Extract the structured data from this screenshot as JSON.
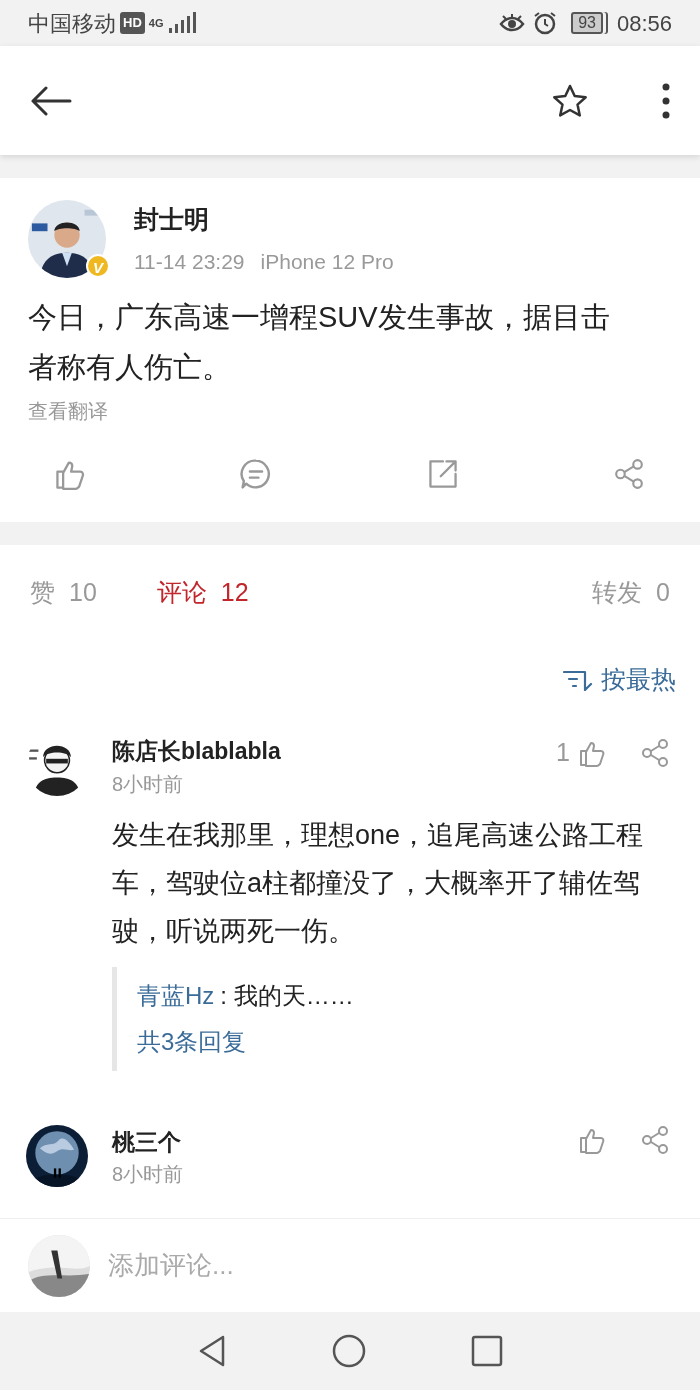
{
  "status_bar": {
    "carrier": "中国移动",
    "hd": "HD",
    "network": "4G",
    "battery": "93",
    "time": "08:56"
  },
  "post": {
    "author": "封士明",
    "verified": "V",
    "time": "11-14 23:29",
    "device": "iPhone 12 Pro",
    "text": "今日，广东高速一增程SUV发生事故，据目击者称有人伤亡。",
    "translate": "查看翻译"
  },
  "stats": [
    {
      "label": "赞",
      "count": "10",
      "selected": false
    },
    {
      "label": "评论",
      "count": "12",
      "selected": true
    },
    {
      "label": "转发",
      "count": "0",
      "selected": false
    }
  ],
  "sort": {
    "label": "按最热"
  },
  "comments": [
    {
      "author": "陈店长blablabla",
      "time": "8小时前",
      "likes": "1",
      "text": "发生在我那里，理想one，追尾高速公路工程车，驾驶位a柱都撞没了，大概率开了辅佐驾驶，听说两死一伤。",
      "replies": [
        {
          "author": "青蓝Hz",
          "text": ": 我的天……"
        }
      ],
      "more_replies": "共3条回复"
    },
    {
      "author": "桃三个",
      "time": "8小时前"
    }
  ],
  "comment_input": {
    "placeholder": "添加评论..."
  }
}
